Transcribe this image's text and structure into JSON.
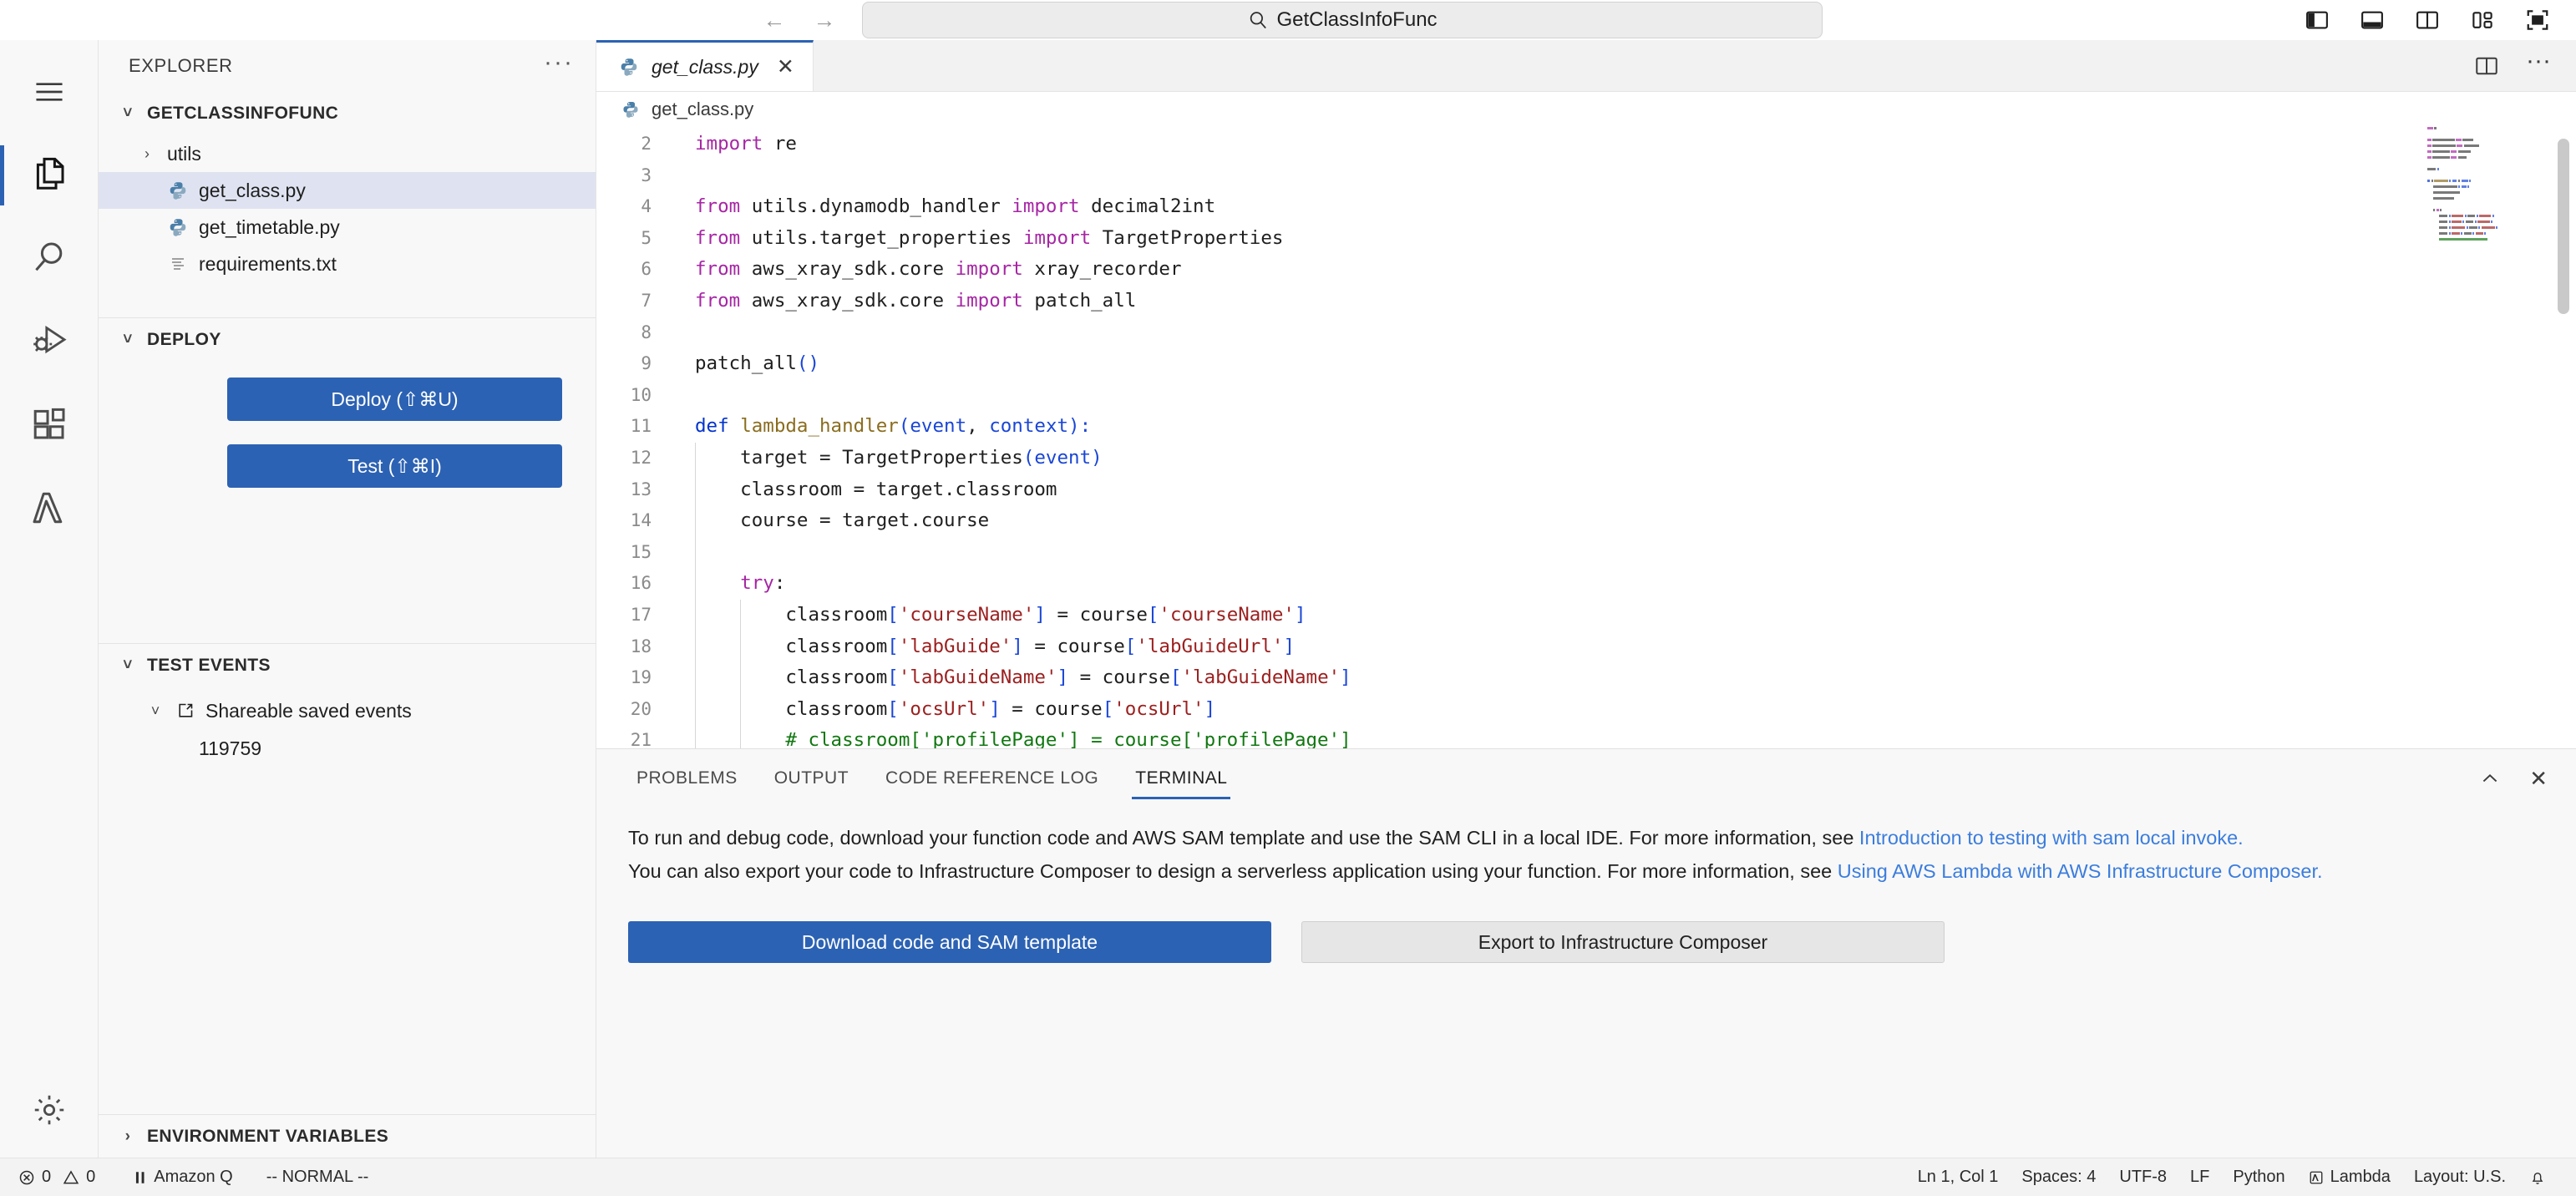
{
  "titlebar": {
    "back_icon": "arrow-left-icon",
    "forward_icon": "arrow-right-icon",
    "command_center_text": "GetClassInfoFunc",
    "command_center_icon": "search-icon",
    "layout_icons": [
      "toggle-primary-sidebar-icon",
      "toggle-panel-icon",
      "toggle-secondary-sidebar-icon",
      "customize-layout-icon",
      "fullscreen-icon"
    ]
  },
  "activitybar": {
    "menu_icon": "hamburger-menu-icon",
    "items": [
      {
        "name": "explorer",
        "icon": "files-icon",
        "active": true
      },
      {
        "name": "search",
        "icon": "search-icon",
        "active": false
      },
      {
        "name": "run-and-debug",
        "icon": "run-debug-icon",
        "active": false
      },
      {
        "name": "extensions",
        "icon": "extensions-icon",
        "active": false
      },
      {
        "name": "lambda",
        "icon": "lambda-icon",
        "active": false
      }
    ],
    "manage_icon": "gear-icon"
  },
  "sidebar": {
    "title": "EXPLORER",
    "more_actions": "···",
    "explorer": {
      "header": "GETCLASSINFOFUNC",
      "collapsed": false,
      "items": [
        {
          "label": "utils",
          "type": "folder",
          "icon": "chevron-right-icon",
          "selected": false
        },
        {
          "label": "get_class.py",
          "type": "python",
          "icon": "python-file-icon",
          "selected": true
        },
        {
          "label": "get_timetable.py",
          "type": "python",
          "icon": "python-file-icon",
          "selected": false
        },
        {
          "label": "requirements.txt",
          "type": "text",
          "icon": "text-file-icon",
          "selected": false
        }
      ]
    },
    "deploy": {
      "header": "DEPLOY",
      "deploy_button": "Deploy (⇧⌘U)",
      "test_button": "Test (⇧⌘I)"
    },
    "test_events": {
      "header": "TEST EVENTS",
      "group_label": "Shareable saved events",
      "group_icon": "external-link-icon",
      "events": [
        "119759"
      ]
    },
    "environment_variables": {
      "header": "ENVIRONMENT VARIABLES",
      "collapsed": true
    }
  },
  "editor": {
    "tabs": [
      {
        "label": "get_class.py",
        "icon": "python-file-icon",
        "close_icon": "close-icon",
        "active": true,
        "preview": true
      }
    ],
    "tab_actions": [
      "split-editor-icon",
      "more-actions-icon"
    ],
    "breadcrumb": {
      "icon": "python-file-icon",
      "label": "get_class.py"
    },
    "lines": [
      {
        "num": "2",
        "indent": 0,
        "tokens": [
          {
            "t": "import",
            "c": "k"
          },
          {
            "t": " re",
            "c": ""
          }
        ]
      },
      {
        "num": "3",
        "indent": 0,
        "tokens": []
      },
      {
        "num": "4",
        "indent": 0,
        "tokens": [
          {
            "t": "from",
            "c": "k"
          },
          {
            "t": " utils.dynamodb_handler ",
            "c": ""
          },
          {
            "t": "import",
            "c": "k"
          },
          {
            "t": " decimal2int",
            "c": ""
          }
        ]
      },
      {
        "num": "5",
        "indent": 0,
        "tokens": [
          {
            "t": "from",
            "c": "k"
          },
          {
            "t": " utils.target_properties ",
            "c": ""
          },
          {
            "t": "import",
            "c": "k"
          },
          {
            "t": " TargetProperties",
            "c": ""
          }
        ]
      },
      {
        "num": "6",
        "indent": 0,
        "tokens": [
          {
            "t": "from",
            "c": "k"
          },
          {
            "t": " aws_xray_sdk.core ",
            "c": ""
          },
          {
            "t": "import",
            "c": "k"
          },
          {
            "t": " xray_recorder",
            "c": ""
          }
        ]
      },
      {
        "num": "7",
        "indent": 0,
        "tokens": [
          {
            "t": "from",
            "c": "k"
          },
          {
            "t": " aws_xray_sdk.core ",
            "c": ""
          },
          {
            "t": "import",
            "c": "k"
          },
          {
            "t": " patch_all",
            "c": ""
          }
        ]
      },
      {
        "num": "8",
        "indent": 0,
        "tokens": []
      },
      {
        "num": "9",
        "indent": 0,
        "tokens": [
          {
            "t": "patch_all",
            "c": ""
          },
          {
            "t": "()",
            "c": "pa"
          }
        ]
      },
      {
        "num": "10",
        "indent": 0,
        "tokens": []
      },
      {
        "num": "11",
        "indent": 0,
        "tokens": [
          {
            "t": "def",
            "c": "kd"
          },
          {
            "t": " ",
            "c": ""
          },
          {
            "t": "lambda_handler",
            "c": "fn"
          },
          {
            "t": "(",
            "c": "pa"
          },
          {
            "t": "event",
            "c": "pa"
          },
          {
            "t": ", ",
            "c": ""
          },
          {
            "t": "context",
            "c": "pa"
          },
          {
            "t": "):",
            "c": "pa"
          }
        ]
      },
      {
        "num": "12",
        "indent": 1,
        "tokens": [
          {
            "t": "    target = TargetProperties",
            "c": ""
          },
          {
            "t": "(",
            "c": "pa"
          },
          {
            "t": "event",
            "c": "pa"
          },
          {
            "t": ")",
            "c": "pa"
          }
        ]
      },
      {
        "num": "13",
        "indent": 1,
        "tokens": [
          {
            "t": "    classroom = target.classroom",
            "c": ""
          }
        ]
      },
      {
        "num": "14",
        "indent": 1,
        "tokens": [
          {
            "t": "    course = target.course",
            "c": ""
          }
        ]
      },
      {
        "num": "15",
        "indent": 1,
        "tokens": []
      },
      {
        "num": "16",
        "indent": 1,
        "tokens": [
          {
            "t": "    ",
            "c": ""
          },
          {
            "t": "try",
            "c": "k"
          },
          {
            "t": ":",
            "c": ""
          }
        ]
      },
      {
        "num": "17",
        "indent": 2,
        "tokens": [
          {
            "t": "        classroom",
            "c": ""
          },
          {
            "t": "[",
            "c": "pa"
          },
          {
            "t": "'courseName'",
            "c": "st"
          },
          {
            "t": "]",
            "c": "pa"
          },
          {
            "t": " = course",
            "c": ""
          },
          {
            "t": "[",
            "c": "pa"
          },
          {
            "t": "'courseName'",
            "c": "st"
          },
          {
            "t": "]",
            "c": "pa"
          }
        ]
      },
      {
        "num": "18",
        "indent": 2,
        "tokens": [
          {
            "t": "        classroom",
            "c": ""
          },
          {
            "t": "[",
            "c": "pa"
          },
          {
            "t": "'labGuide'",
            "c": "st"
          },
          {
            "t": "]",
            "c": "pa"
          },
          {
            "t": " = course",
            "c": ""
          },
          {
            "t": "[",
            "c": "pa"
          },
          {
            "t": "'labGuideUrl'",
            "c": "st"
          },
          {
            "t": "]",
            "c": "pa"
          }
        ]
      },
      {
        "num": "19",
        "indent": 2,
        "tokens": [
          {
            "t": "        classroom",
            "c": ""
          },
          {
            "t": "[",
            "c": "pa"
          },
          {
            "t": "'labGuideName'",
            "c": "st"
          },
          {
            "t": "]",
            "c": "pa"
          },
          {
            "t": " = course",
            "c": ""
          },
          {
            "t": "[",
            "c": "pa"
          },
          {
            "t": "'labGuideName'",
            "c": "st"
          },
          {
            "t": "]",
            "c": "pa"
          }
        ]
      },
      {
        "num": "20",
        "indent": 2,
        "tokens": [
          {
            "t": "        classroom",
            "c": ""
          },
          {
            "t": "[",
            "c": "pa"
          },
          {
            "t": "'ocsUrl'",
            "c": "st"
          },
          {
            "t": "]",
            "c": "pa"
          },
          {
            "t": " = course",
            "c": ""
          },
          {
            "t": "[",
            "c": "pa"
          },
          {
            "t": "'ocsUrl'",
            "c": "st"
          },
          {
            "t": "]",
            "c": "pa"
          }
        ]
      },
      {
        "num": "21",
        "indent": 2,
        "tokens": [
          {
            "t": "        # classroom['profilePage'] = course['profilePage']",
            "c": "cm"
          }
        ]
      }
    ]
  },
  "panel": {
    "tabs": [
      {
        "label": "PROBLEMS",
        "active": false
      },
      {
        "label": "OUTPUT",
        "active": false
      },
      {
        "label": "CODE REFERENCE LOG",
        "active": false
      },
      {
        "label": "TERMINAL",
        "active": true
      }
    ],
    "actions": [
      "chevron-up-icon",
      "close-icon"
    ],
    "paragraph1_pre": "To run and debug code, download your function code and AWS SAM template and use the SAM CLI in a local IDE. For more information, see ",
    "paragraph1_link": "Introduction to testing with sam local invoke.",
    "paragraph2_pre": "You can also export your code to Infrastructure Composer to design a serverless application using your function. For more information, see ",
    "paragraph2_link": "Using AWS Lambda with AWS Infrastructure Composer.",
    "primary_button": "Download code and SAM template",
    "secondary_button": "Export to Infrastructure Composer"
  },
  "statusbar": {
    "left": [
      {
        "name": "errors-warnings",
        "icon": "error-icon",
        "label": "0",
        "icon2": "warning-icon",
        "label2": "0"
      },
      {
        "name": "amazon-q",
        "icon": "pause-icon",
        "label": "Amazon Q"
      },
      {
        "name": "vim-mode",
        "label": "-- NORMAL --"
      }
    ],
    "right": [
      {
        "name": "cursor-position",
        "label": "Ln 1, Col 1"
      },
      {
        "name": "indentation",
        "label": "Spaces: 4"
      },
      {
        "name": "encoding",
        "label": "UTF-8"
      },
      {
        "name": "eol",
        "label": "LF"
      },
      {
        "name": "language-mode",
        "label": "Python"
      },
      {
        "name": "lambda-connection",
        "icon": "lambda-status-icon",
        "label": "Lambda"
      },
      {
        "name": "keyboard-layout",
        "label": "Layout: U.S."
      },
      {
        "name": "notifications",
        "icon": "bell-icon",
        "label": ""
      }
    ]
  },
  "colors": {
    "accent": "#2c62b3",
    "link": "#3b7ddd",
    "selection": "#dfe3f1",
    "panel_bg": "#f8f8f8"
  }
}
